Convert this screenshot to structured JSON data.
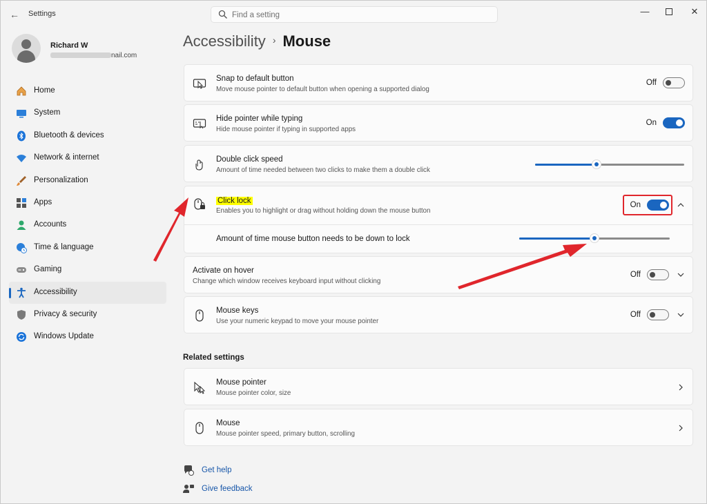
{
  "window": {
    "app_title": "Settings",
    "search": {
      "placeholder": "Find a setting",
      "value": ""
    }
  },
  "profile": {
    "name": "Richard W",
    "email_suffix": "nail.com"
  },
  "sidebar": {
    "items": [
      {
        "label": "Home",
        "icon": "home-icon",
        "active": false
      },
      {
        "label": "System",
        "icon": "system-icon",
        "active": false
      },
      {
        "label": "Bluetooth & devices",
        "icon": "bluetooth-icon",
        "active": false
      },
      {
        "label": "Network & internet",
        "icon": "wifi-icon",
        "active": false
      },
      {
        "label": "Personalization",
        "icon": "brush-icon",
        "active": false
      },
      {
        "label": "Apps",
        "icon": "apps-icon",
        "active": false
      },
      {
        "label": "Accounts",
        "icon": "accounts-icon",
        "active": false
      },
      {
        "label": "Time & language",
        "icon": "globe-clock-icon",
        "active": false
      },
      {
        "label": "Gaming",
        "icon": "gamepad-icon",
        "active": false
      },
      {
        "label": "Accessibility",
        "icon": "accessibility-icon",
        "active": true
      },
      {
        "label": "Privacy & security",
        "icon": "shield-icon",
        "active": false
      },
      {
        "label": "Windows Update",
        "icon": "update-icon",
        "active": false
      }
    ]
  },
  "header": {
    "parent": "Accessibility",
    "current": "Mouse"
  },
  "settings": {
    "snap": {
      "title": "Snap to default button",
      "desc": "Move mouse pointer to default button when opening a supported dialog",
      "state": "Off"
    },
    "hide_pointer": {
      "title": "Hide pointer while typing",
      "desc": "Hide mouse pointer if typing in supported apps",
      "state": "On"
    },
    "double_click": {
      "title": "Double click speed",
      "desc": "Amount of time needed between two clicks to make them a double click",
      "level": 0.41
    },
    "click_lock": {
      "title": "Click lock",
      "desc": "Enables you to highlight or drag without holding down the mouse button",
      "state": "On",
      "expanded": true
    },
    "click_lock_time": {
      "label": "Amount of time mouse button needs to be down to lock",
      "level": 0.5
    },
    "activate_hover": {
      "title": "Activate on hover",
      "desc": "Change which window receives keyboard input without clicking",
      "state": "Off"
    },
    "mouse_keys": {
      "title": "Mouse keys",
      "desc": "Use your numeric keypad to move your mouse pointer",
      "state": "Off"
    }
  },
  "related": {
    "heading": "Related settings",
    "mouse_pointer": {
      "title": "Mouse pointer",
      "desc": "Mouse pointer color, size"
    },
    "mouse": {
      "title": "Mouse",
      "desc": "Mouse pointer speed, primary button, scrolling"
    }
  },
  "footer": {
    "get_help": "Get help",
    "give_feedback": "Give feedback"
  },
  "colors": {
    "accent": "#1a66c0",
    "annotation": "#e0262c",
    "highlight": "#ffff00"
  }
}
